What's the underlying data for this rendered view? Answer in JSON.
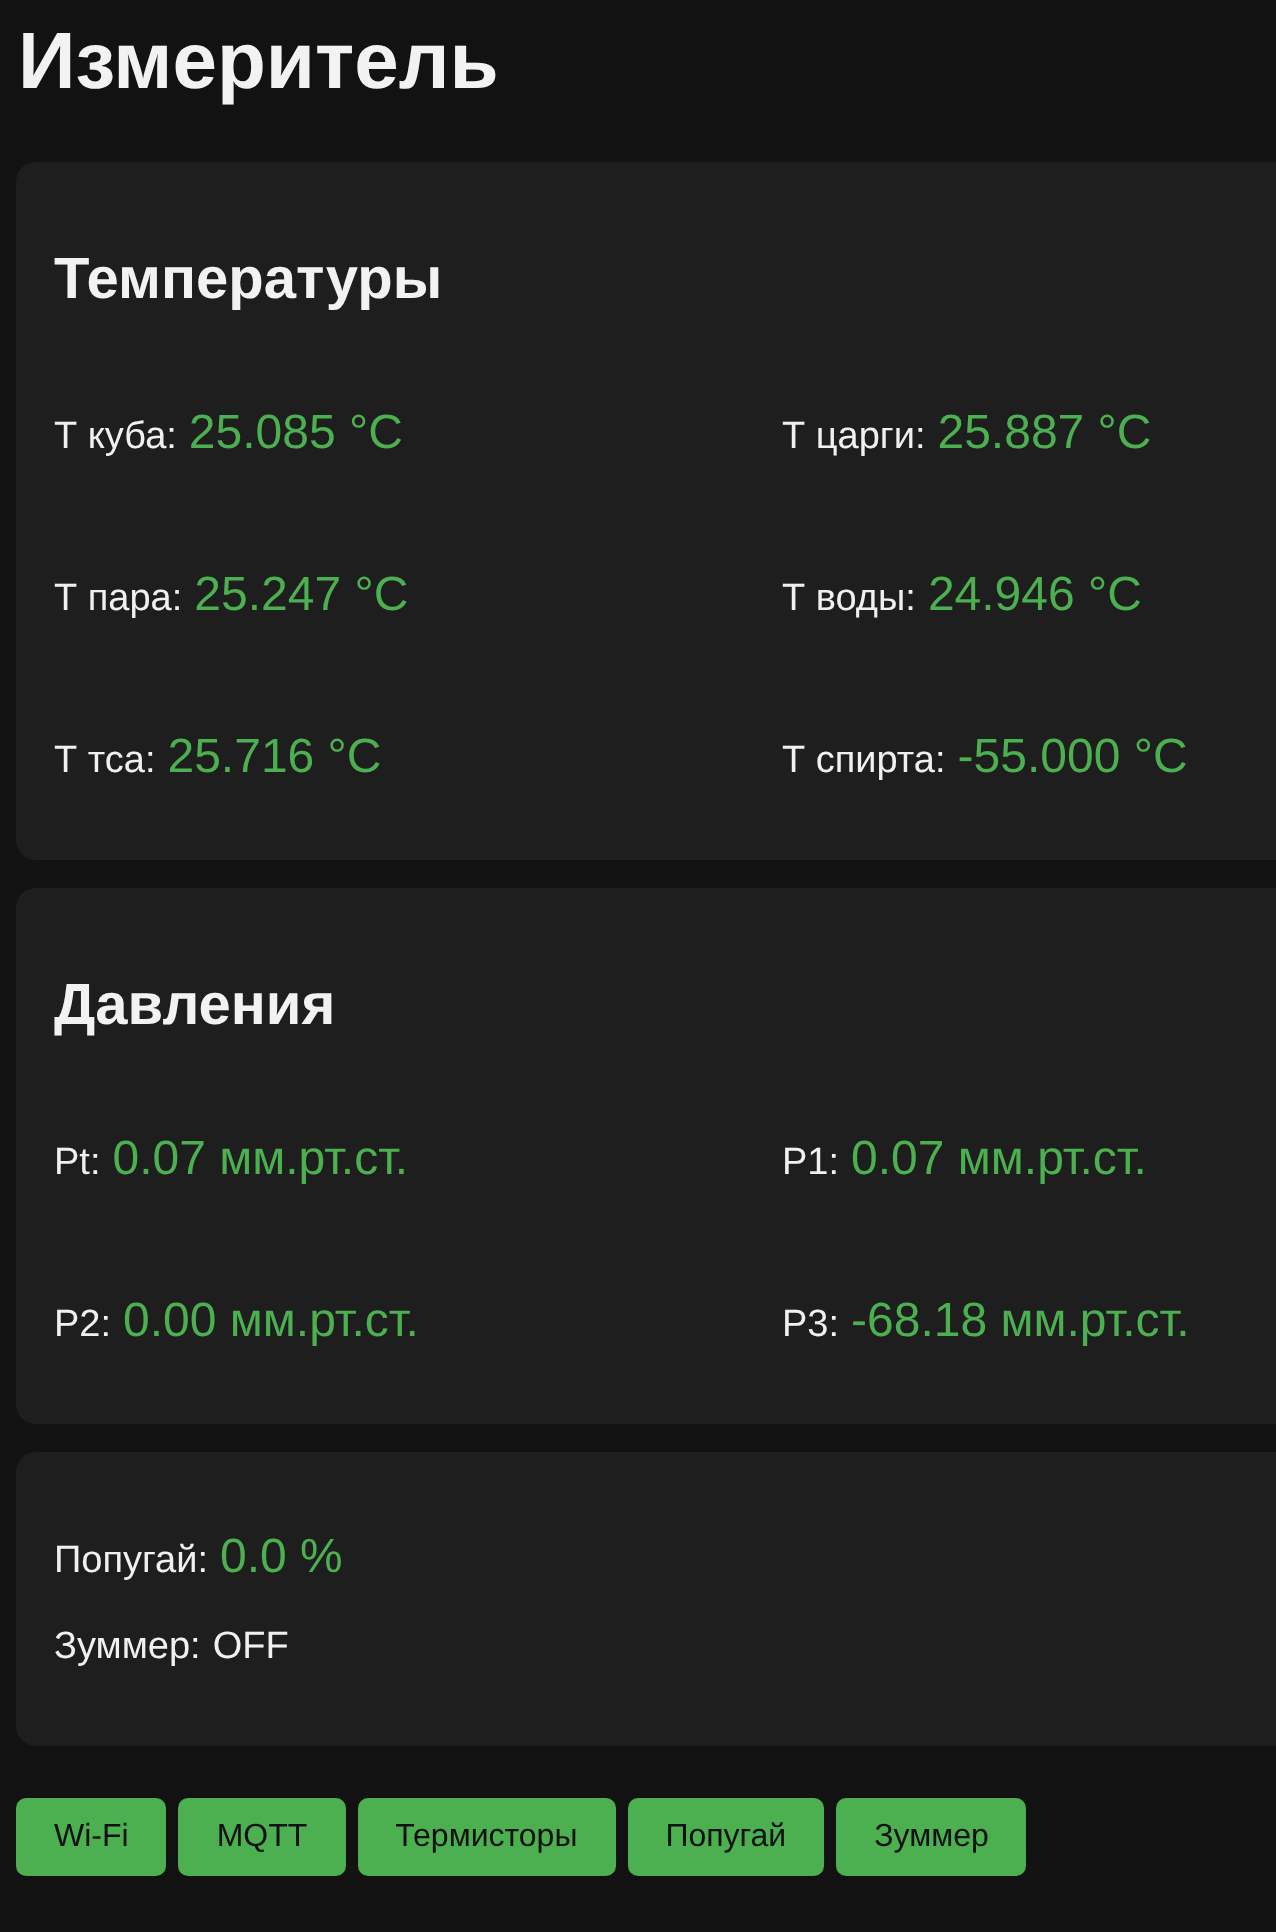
{
  "title": "Измеритель",
  "cards": [
    {
      "kind": "grid",
      "heading": "Температуры",
      "readings": [
        {
          "kind": "value",
          "label": "Т куба:",
          "value": "25.085 °C"
        },
        {
          "kind": "value",
          "label": "Т царги:",
          "value": "25.887 °C"
        },
        {
          "kind": "value",
          "label": "Т пара:",
          "value": "25.247 °C"
        },
        {
          "kind": "value",
          "label": "Т воды:",
          "value": "24.946 °C"
        },
        {
          "kind": "value",
          "label": "Т тса:",
          "value": "25.716 °C"
        },
        {
          "kind": "value",
          "label": "Т спирта:",
          "value": "-55.000 °C"
        }
      ]
    },
    {
      "kind": "grid",
      "heading": "Давления",
      "readings": [
        {
          "kind": "value",
          "label": "Pt:",
          "value": "0.07 мм.рт.ст."
        },
        {
          "kind": "value",
          "label": "P1:",
          "value": "0.07 мм.рт.ст."
        },
        {
          "kind": "value",
          "label": "P2:",
          "value": "0.00 мм.рт.ст."
        },
        {
          "kind": "value",
          "label": "P3:",
          "value": "-68.18 мм.рт.ст."
        }
      ]
    },
    {
      "kind": "list",
      "readings": [
        {
          "kind": "value",
          "label": "Попугай:",
          "value": "0.0 %"
        },
        {
          "kind": "status",
          "label": "Зуммер:",
          "value": "OFF"
        }
      ]
    }
  ],
  "buttons": [
    "Wi-Fi",
    "MQTT",
    "Термисторы",
    "Попугай",
    "Зуммер"
  ]
}
